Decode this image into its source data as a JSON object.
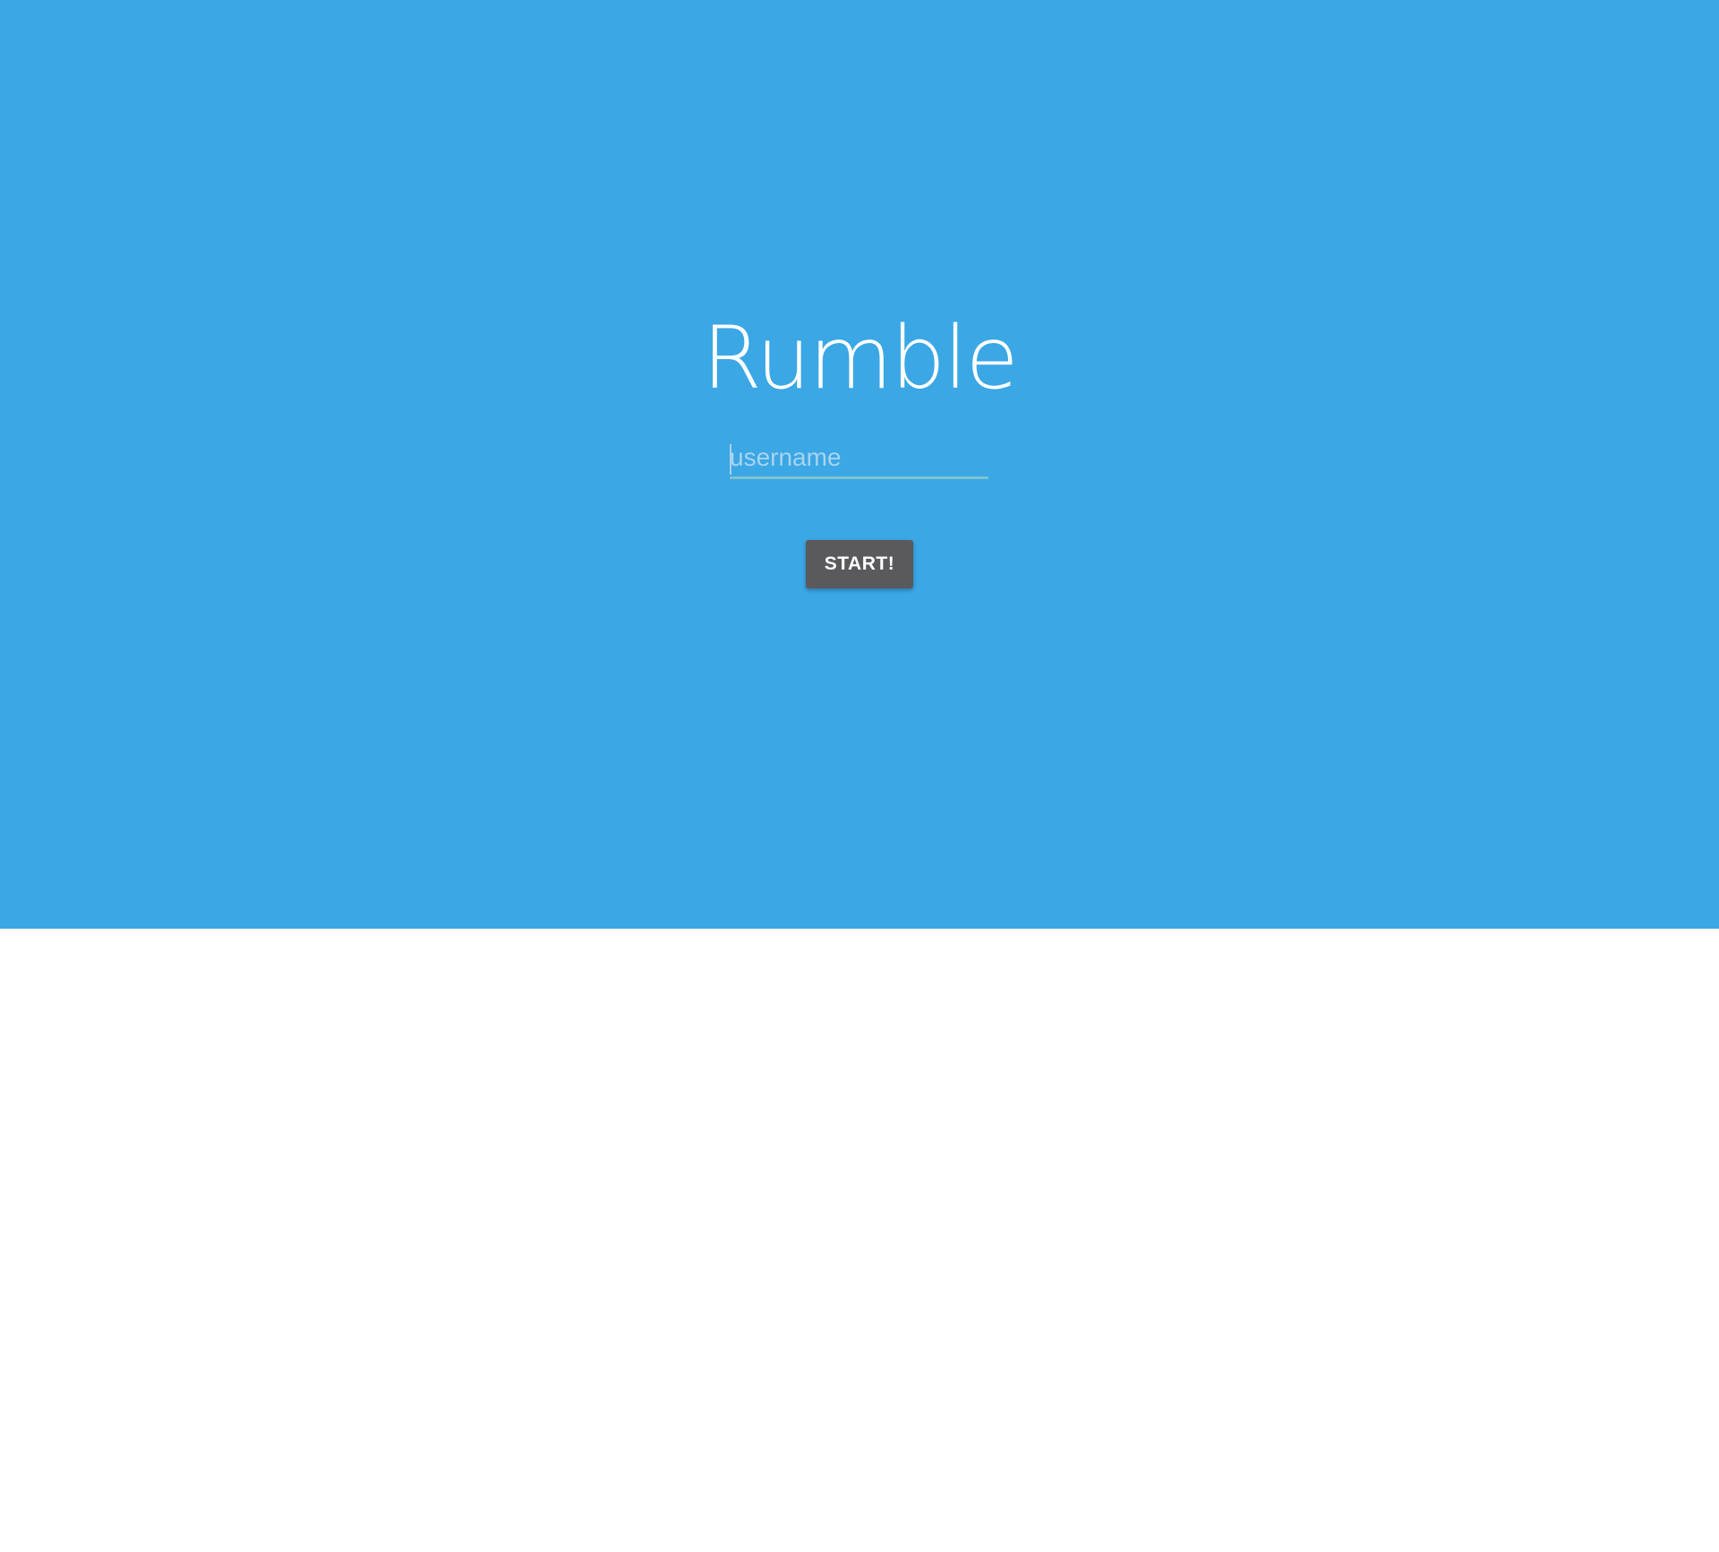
{
  "app": {
    "logo_text": "Rumble"
  },
  "login": {
    "username_placeholder": "username",
    "username_value": "",
    "start_label": "START!"
  },
  "colors": {
    "hero_background": "#3BA7E5",
    "page_background": "#FFFFFF",
    "button_background": "#5A5A5C",
    "input_underline": "#7FC3D3",
    "logo_text": "#FFFFFF"
  }
}
